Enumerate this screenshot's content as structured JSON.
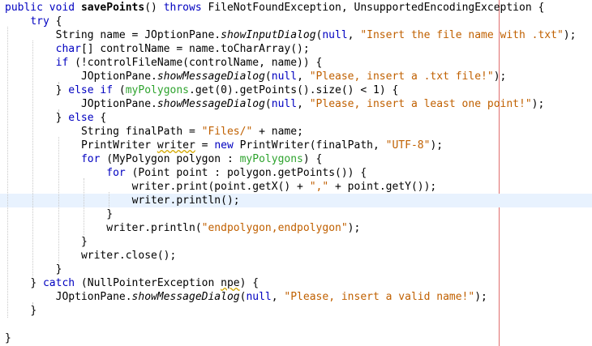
{
  "editor": {
    "lines": [
      {
        "indent": 0,
        "tokens": [
          {
            "t": "public",
            "c": "kwb"
          },
          {
            "t": " "
          },
          {
            "t": "void",
            "c": "kwb"
          },
          {
            "t": " "
          },
          {
            "t": "savePoints",
            "c": "bold"
          },
          {
            "t": "() "
          },
          {
            "t": "throws",
            "c": "kwb"
          },
          {
            "t": " FileNotFoundException, UnsupportedEncodingException {"
          }
        ]
      },
      {
        "indent": 1,
        "tokens": [
          {
            "t": "try",
            "c": "kwb"
          },
          {
            "t": " {"
          }
        ]
      },
      {
        "indent": 2,
        "tokens": [
          {
            "t": "String name = JOptionPane."
          },
          {
            "t": "showInputDialog",
            "c": "ital"
          },
          {
            "t": "("
          },
          {
            "t": "null",
            "c": "kwb"
          },
          {
            "t": ", "
          },
          {
            "t": "\"Insert the file name with .txt\"",
            "c": "str"
          },
          {
            "t": ");"
          }
        ]
      },
      {
        "indent": 2,
        "tokens": [
          {
            "t": "char",
            "c": "kwb"
          },
          {
            "t": "[] controlName = name.toCharArray();"
          }
        ]
      },
      {
        "indent": 2,
        "tokens": [
          {
            "t": "if",
            "c": "kwb"
          },
          {
            "t": " (!controlFileName(controlName, name)) {"
          }
        ]
      },
      {
        "indent": 3,
        "tokens": [
          {
            "t": "JOptionPane."
          },
          {
            "t": "showMessageDialog",
            "c": "ital"
          },
          {
            "t": "("
          },
          {
            "t": "null",
            "c": "kwb"
          },
          {
            "t": ", "
          },
          {
            "t": "\"Please, insert a .txt file!\"",
            "c": "str"
          },
          {
            "t": ");"
          }
        ]
      },
      {
        "indent": 2,
        "tokens": [
          {
            "t": "} "
          },
          {
            "t": "else",
            "c": "kwb"
          },
          {
            "t": " "
          },
          {
            "t": "if",
            "c": "kwb"
          },
          {
            "t": " ("
          },
          {
            "t": "myPolygons",
            "c": "fld"
          },
          {
            "t": ".get(0).getPoints().size() < 1) {"
          }
        ]
      },
      {
        "indent": 3,
        "tokens": [
          {
            "t": "JOptionPane."
          },
          {
            "t": "showMessageDialog",
            "c": "ital"
          },
          {
            "t": "("
          },
          {
            "t": "null",
            "c": "kwb"
          },
          {
            "t": ", "
          },
          {
            "t": "\"Please, insert a least one point!\"",
            "c": "str"
          },
          {
            "t": ");"
          }
        ]
      },
      {
        "indent": 2,
        "tokens": [
          {
            "t": "} "
          },
          {
            "t": "else",
            "c": "kwb"
          },
          {
            "t": " {"
          }
        ]
      },
      {
        "indent": 3,
        "tokens": [
          {
            "t": "String finalPath = "
          },
          {
            "t": "\"Files/\"",
            "c": "str"
          },
          {
            "t": " + name;"
          }
        ]
      },
      {
        "indent": 3,
        "tokens": [
          {
            "t": "PrintWriter "
          },
          {
            "t": "writer",
            "c": "warn"
          },
          {
            "t": " = "
          },
          {
            "t": "new",
            "c": "kwb"
          },
          {
            "t": " PrintWriter(finalPath, "
          },
          {
            "t": "\"UTF-8\"",
            "c": "str"
          },
          {
            "t": ");"
          }
        ]
      },
      {
        "indent": 3,
        "tokens": [
          {
            "t": "for",
            "c": "kwb"
          },
          {
            "t": " (MyPolygon polygon : "
          },
          {
            "t": "myPolygons",
            "c": "fld"
          },
          {
            "t": ") {"
          }
        ]
      },
      {
        "indent": 4,
        "tokens": [
          {
            "t": "for",
            "c": "kwb"
          },
          {
            "t": " (Point point : polygon.getPoints()) {"
          }
        ]
      },
      {
        "indent": 5,
        "tokens": [
          {
            "t": "writer.print(point.getX() + "
          },
          {
            "t": "\",\"",
            "c": "str"
          },
          {
            "t": " + point.getY());"
          }
        ]
      },
      {
        "indent": 5,
        "current": true,
        "tokens": [
          {
            "t": "writer.println();"
          }
        ]
      },
      {
        "indent": 4,
        "tokens": [
          {
            "t": "}"
          }
        ]
      },
      {
        "indent": 4,
        "tokens": [
          {
            "t": "writer.println("
          },
          {
            "t": "\"endpolygon,endpolygon\"",
            "c": "str"
          },
          {
            "t": ");"
          }
        ]
      },
      {
        "indent": 3,
        "tokens": [
          {
            "t": "}"
          }
        ]
      },
      {
        "indent": 3,
        "tokens": [
          {
            "t": "writer.close();"
          }
        ]
      },
      {
        "indent": 2,
        "tokens": [
          {
            "t": "}"
          }
        ]
      },
      {
        "indent": 1,
        "tokens": [
          {
            "t": "} "
          },
          {
            "t": "catch",
            "c": "kwb"
          },
          {
            "t": " (NullPointerException "
          },
          {
            "t": "npe",
            "c": "warn"
          },
          {
            "t": ") {"
          }
        ]
      },
      {
        "indent": 2,
        "tokens": [
          {
            "t": "JOptionPane."
          },
          {
            "t": "showMessageDialog",
            "c": "ital"
          },
          {
            "t": "("
          },
          {
            "t": "null",
            "c": "kwb"
          },
          {
            "t": ", "
          },
          {
            "t": "\"Please, insert a valid name!\"",
            "c": "str"
          },
          {
            "t": ");"
          }
        ]
      },
      {
        "indent": 1,
        "tokens": [
          {
            "t": "}"
          }
        ]
      },
      {
        "indent": 0,
        "tokens": []
      },
      {
        "indent": 0,
        "tokens": [
          {
            "t": "}"
          }
        ]
      }
    ]
  }
}
